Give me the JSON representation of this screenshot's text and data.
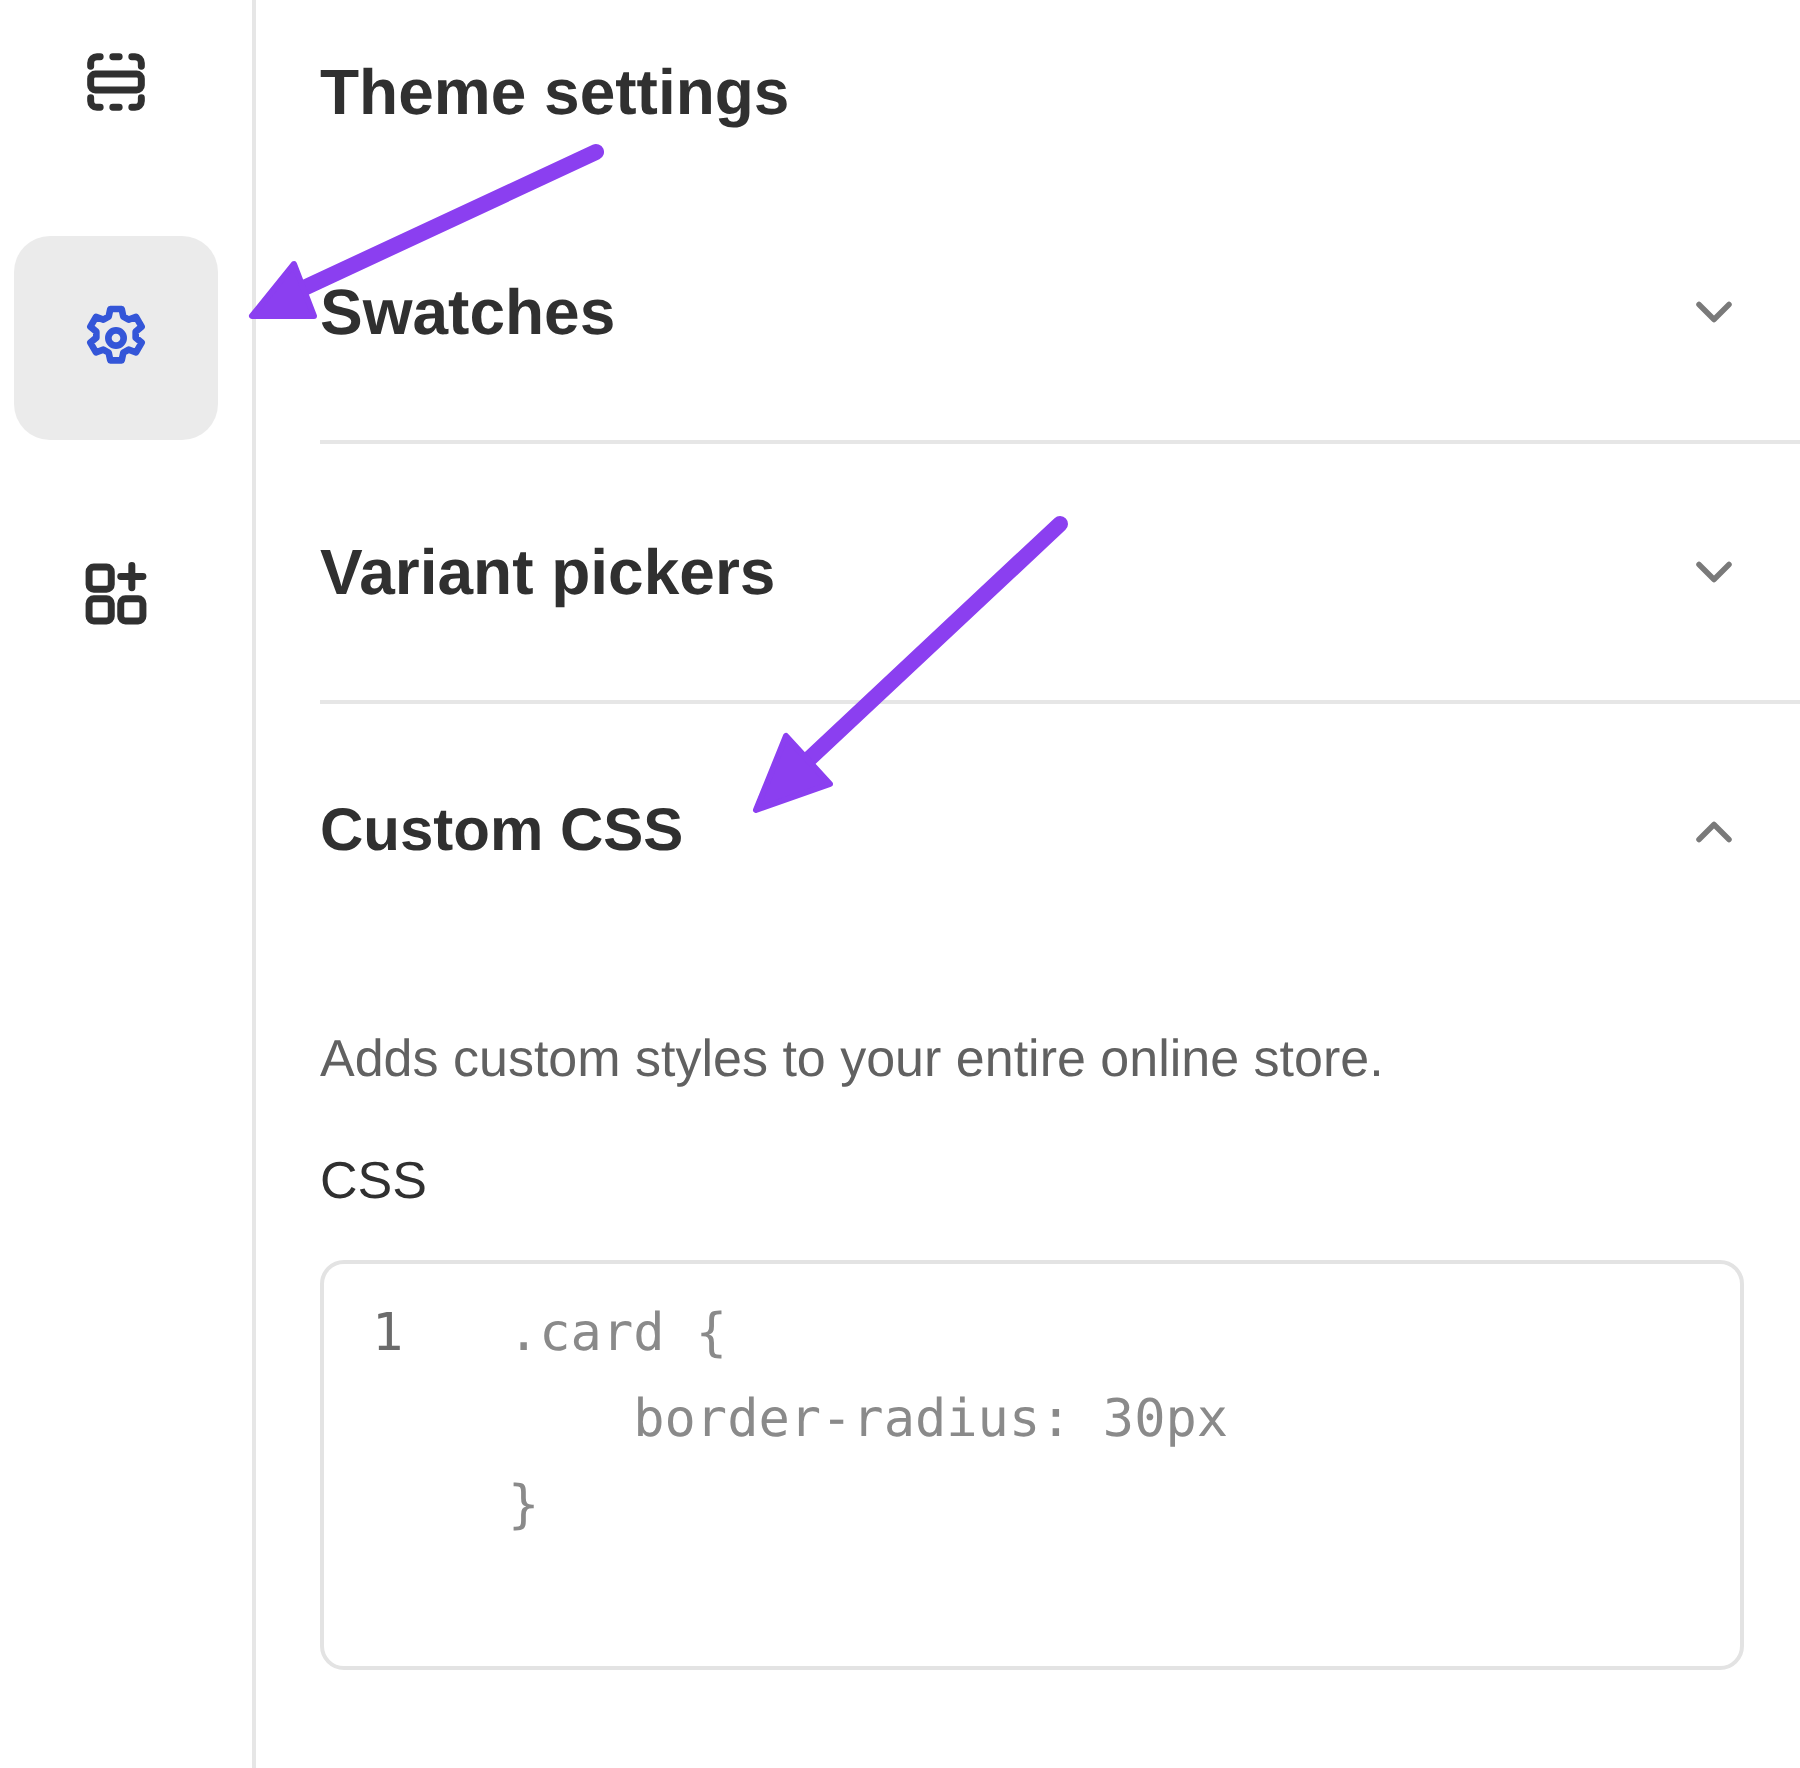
{
  "sidebar": {
    "items": [
      {
        "kind": "sections",
        "selected": false
      },
      {
        "kind": "settings",
        "selected": true
      },
      {
        "kind": "apps",
        "selected": false
      }
    ]
  },
  "panel": {
    "title": "Theme settings",
    "sections": [
      {
        "title": "Swatches",
        "expanded": false
      },
      {
        "title": "Variant pickers",
        "expanded": false
      },
      {
        "title": "Custom CSS",
        "expanded": true,
        "description": "Adds custom styles to your entire online store.",
        "field_label": "CSS",
        "line_numbers": [
          "1"
        ],
        "code_lines": [
          ".card {",
          "    border-radius: 30px",
          "}"
        ]
      }
    ]
  }
}
